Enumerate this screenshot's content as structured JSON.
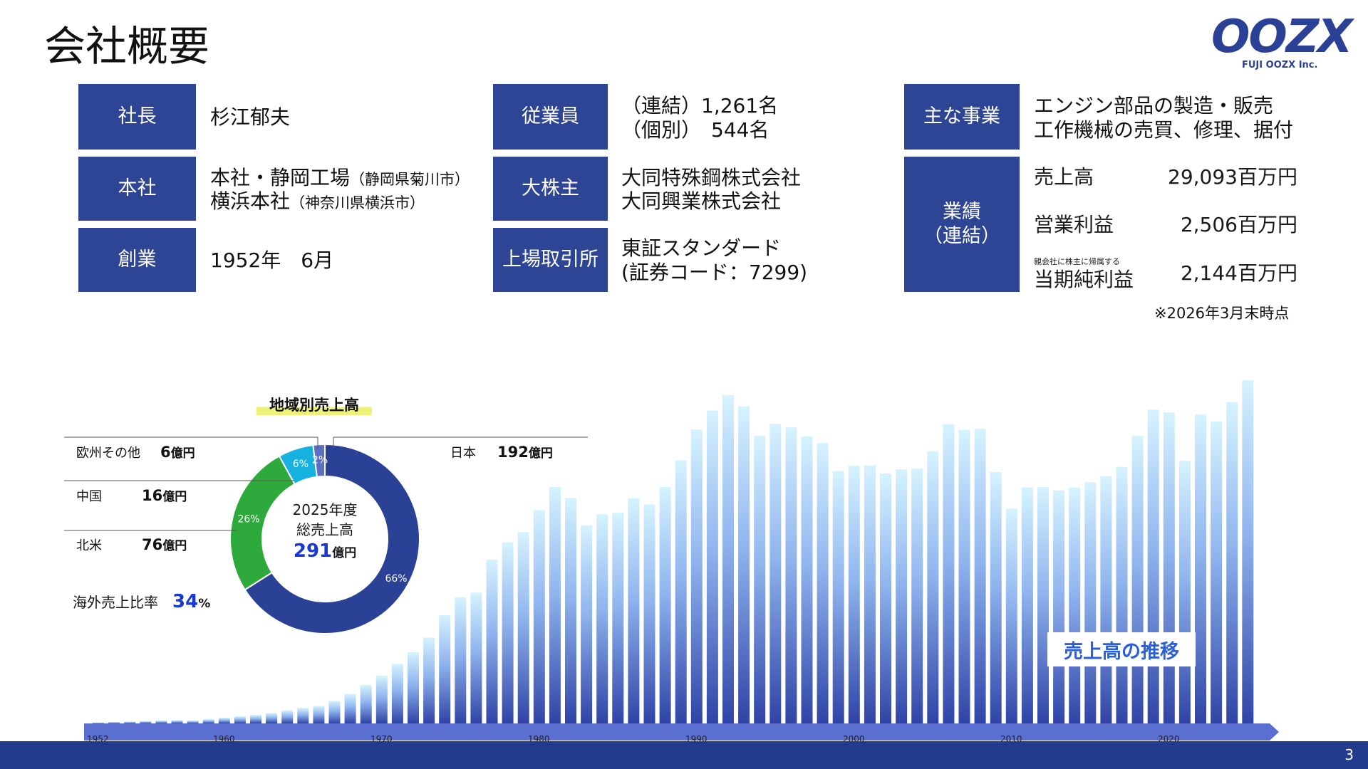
{
  "header": {
    "title": "会社概要",
    "logo_text": "OOZX",
    "logo_sub": "FUJI OOZX Inc."
  },
  "info": {
    "president": {
      "label": "社長",
      "value": "杉江郁夫"
    },
    "hq": {
      "label": "本社",
      "line1": "本社・静岡工場",
      "line1_note": "（静岡県菊川市）",
      "line2": "横浜本社",
      "line2_note": "（神奈川県横浜市）"
    },
    "founded": {
      "label": "創業",
      "value": "1952年　6月"
    },
    "employees": {
      "label": "従業員",
      "line1": "（連結）1,261名",
      "line2": "（個別）　544名"
    },
    "shareholders": {
      "label": "大株主",
      "line1": "大同特殊鋼株式会社",
      "line2": "大同興業株式会社"
    },
    "exchange": {
      "label": "上場取引所",
      "line1": "東証スタンダード",
      "line2": "(証券コード：7299)"
    },
    "business": {
      "label": "主な事業",
      "line1": "エンジン部品の製造・販売",
      "line2": "工作機械の売買、修理、据付"
    },
    "performance": {
      "label1": "業績",
      "label2": "（連結）",
      "rows": [
        {
          "name": "売上高",
          "value": "29,093百万円"
        },
        {
          "name": "営業利益",
          "value": "2,506百万円"
        },
        {
          "note": "親会社に株主に帰属する",
          "name": "当期純利益",
          "value": "2,144百万円"
        }
      ]
    },
    "note": "※2026年3月末時点"
  },
  "donut": {
    "title": "地域別売上高",
    "center_line1": "2025年度",
    "center_line2": "総売上高",
    "center_value": "291",
    "center_unit": "億円",
    "overseas_label": "海外売上比率",
    "overseas_value": "34",
    "overseas_unit": "%",
    "regions": [
      {
        "name": "日本",
        "value": "192",
        "unit": "億円",
        "pct_label": "66%",
        "color": "#2b4196"
      },
      {
        "name": "北米",
        "value": "76",
        "unit": "億円",
        "pct_label": "26%",
        "color": "#2eaa3c"
      },
      {
        "name": "中国",
        "value": "16",
        "unit": "億円",
        "pct_label": "6%",
        "color": "#17b1e0"
      },
      {
        "name": "欧州その他",
        "value": "6",
        "unit": "億円",
        "pct_label": "2%",
        "color": "#5b6fc4"
      }
    ]
  },
  "trend": {
    "label": "売上高の推移"
  },
  "chart_data": [
    {
      "type": "pie",
      "title": "地域別売上高",
      "categories": [
        "日本",
        "北米",
        "中国",
        "欧州その他"
      ],
      "values": [
        66,
        26,
        6,
        2
      ]
    },
    {
      "type": "bar",
      "title": "売上高の推移",
      "x": [
        1952,
        1953,
        1954,
        1955,
        1956,
        1957,
        1958,
        1959,
        1960,
        1961,
        1962,
        1963,
        1964,
        1965,
        1966,
        1967,
        1968,
        1969,
        1970,
        1971,
        1972,
        1973,
        1974,
        1975,
        1976,
        1977,
        1978,
        1979,
        1980,
        1981,
        1982,
        1983,
        1984,
        1985,
        1986,
        1987,
        1988,
        1989,
        1990,
        1991,
        1992,
        1993,
        1994,
        1995,
        1996,
        1997,
        1998,
        1999,
        2000,
        2001,
        2002,
        2003,
        2004,
        2005,
        2006,
        2007,
        2008,
        2009,
        2010,
        2011,
        2012,
        2013,
        2014,
        2015,
        2016,
        2017,
        2018,
        2019,
        2020,
        2021,
        2022,
        2023,
        2024,
        2025
      ],
      "values": [
        0.2,
        0.3,
        0.4,
        0.5,
        0.6,
        0.7,
        0.6,
        0.9,
        1.2,
        1.5,
        1.8,
        2.2,
        2.8,
        3.3,
        3.7,
        4.8,
        6.3,
        8.2,
        10.2,
        12.7,
        15.2,
        18.3,
        23.1,
        26.9,
        27.9,
        34.9,
        38.6,
        40.8,
        45.5,
        50.4,
        48.1,
        42.2,
        44.6,
        44.9,
        48.0,
        46.7,
        50.4,
        56.1,
        62.7,
        66.7,
        70.0,
        67.6,
        61.3,
        63.9,
        63.1,
        61.2,
        59.8,
        53.8,
        54.9,
        55.0,
        53.3,
        54.2,
        54.3,
        58.0,
        63.8,
        62.6,
        62.8,
        53.6,
        45.8,
        50.3,
        50.4,
        49.7,
        50.3,
        51.4,
        52.7,
        54.7,
        61.3,
        66.9,
        66.3,
        56.0,
        65.9,
        64.4,
        68.5,
        73.2,
        79.7
      ]
    }
  ],
  "xticks": [
    "1952",
    "1960",
    "1970",
    "1980",
    "1990",
    "2000",
    "2010",
    "2020"
  ],
  "page": {
    "number": "3"
  }
}
